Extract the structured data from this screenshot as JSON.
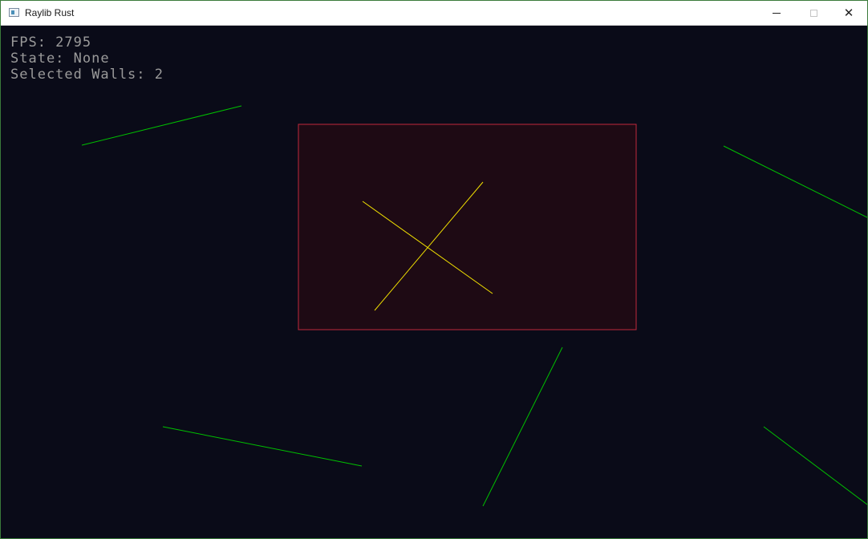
{
  "window": {
    "title": "Raylib Rust",
    "controls": {
      "minimize": "minimize",
      "maximize": "maximize",
      "close": "close"
    }
  },
  "hud": {
    "fps": "FPS: 2795",
    "state": "State: None",
    "selected_walls": "Selected Walls: 2"
  },
  "colors": {
    "background": "#0a0b18",
    "wall": "#00c000",
    "selected_wall": "#f0e000",
    "selection_border": "#c0283c",
    "selection_fill": "#1e0a14",
    "hud_text": "#9a9a9a"
  }
}
